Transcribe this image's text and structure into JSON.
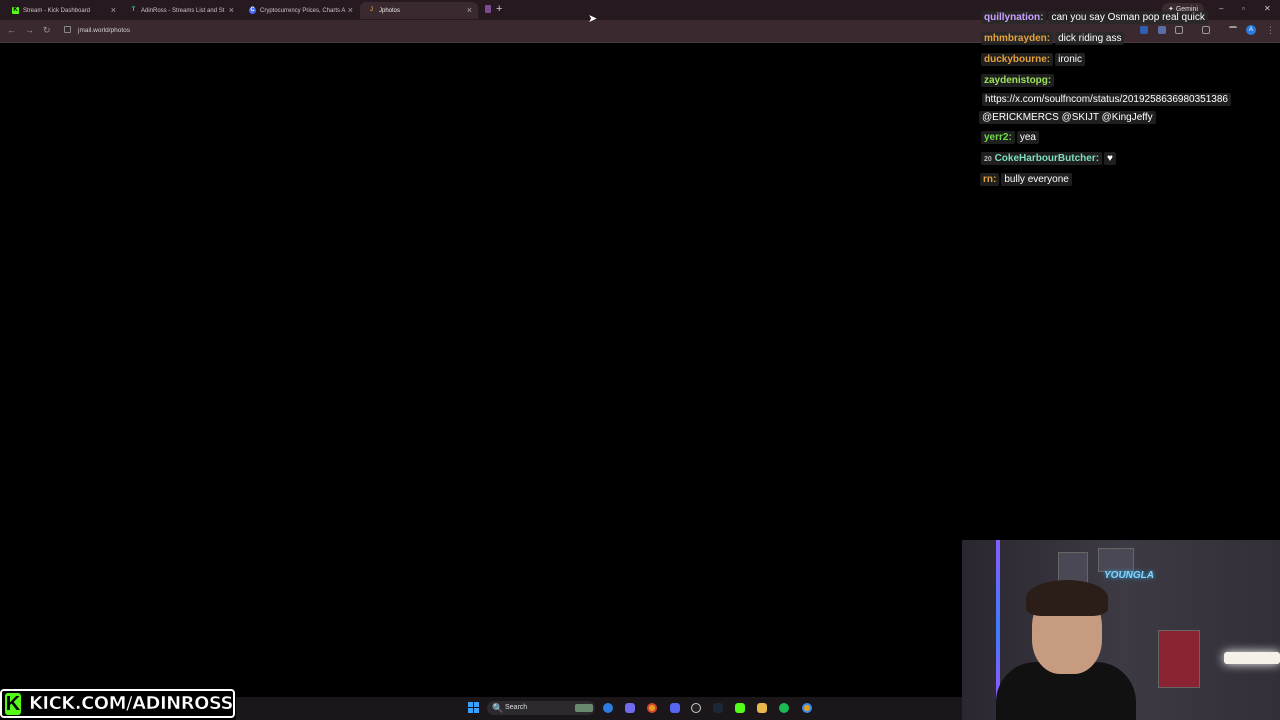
{
  "browser": {
    "tabs": [
      {
        "title": "Stream - Kick Dashboard",
        "icon": "K",
        "color": "#53fc18"
      },
      {
        "title": "AdinRoss - Streams List and St",
        "icon": "T",
        "color": "#2ec4b6"
      },
      {
        "title": "Cryptocurrency Prices, Charts A",
        "icon": "C",
        "color": "#4a6cf7"
      },
      {
        "title": "Jphotos",
        "icon": "J",
        "color": "#b58a3c"
      }
    ],
    "gemini_label": "Gemini",
    "url": "jmail.world/photos"
  },
  "chat": {
    "messages": [
      {
        "user": "quillynation:",
        "text": "can you say Osman pop real quick",
        "color": "#c9a0ff"
      },
      {
        "user": "mhmbrayden:",
        "text": "dick riding ass",
        "color": "#e5a13a"
      },
      {
        "user": "duckybourne:",
        "text": "ironic",
        "color": "#e5a13a"
      },
      {
        "user": "zaydenistopg:",
        "text": "",
        "color": "#9be35a"
      },
      {
        "plain": "https://x.com/soulfncom/status/2019258636980351386"
      },
      {
        "plain": "@ERICKMERCS @SKIJT @KingJeffy"
      },
      {
        "user": "yerr2:",
        "text": "yea",
        "color": "#6fdc4a"
      },
      {
        "user": "CokeHarbourButcher:",
        "text": "",
        "color": "#7fdcc0",
        "badge": "20"
      },
      {
        "user": "rn:",
        "text": "bully everyone",
        "color": "#e5a13a"
      }
    ]
  },
  "webcam": {
    "neon_text": "YOUNGLA"
  },
  "banner": {
    "text": "KICK.COM/ADINROSS",
    "logo": "K",
    "accent": "#53fc18"
  },
  "taskbar": {
    "search_label": "Search",
    "search_icon": "🔍",
    "apps": [
      "edge-icon",
      "copilot-icon",
      "chrome-icon",
      "discord-icon",
      "obs-icon",
      "steam-icon",
      "kick-icon",
      "folder-icon",
      "spotify-icon",
      "chrome-active-icon"
    ]
  }
}
